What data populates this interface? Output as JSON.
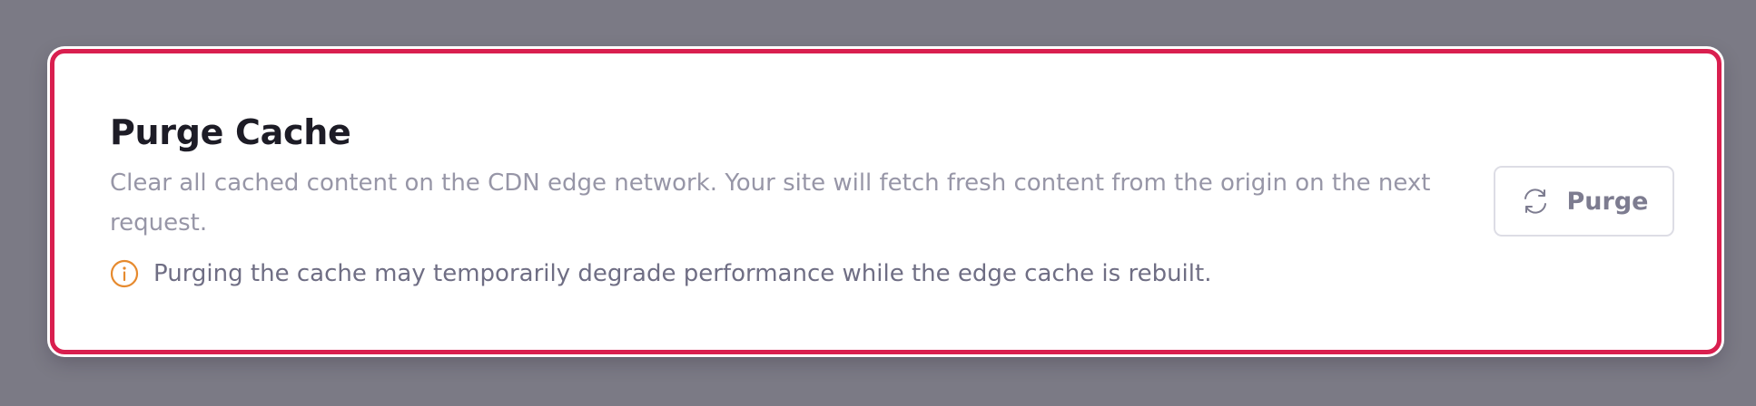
{
  "card": {
    "title": "Purge Cache",
    "description": "Clear all cached content on the CDN edge network. Your site will fetch fresh content from the origin on the next request.",
    "warning": {
      "icon": "info-circle-icon",
      "text": "Purging the cache may temporarily degrade performance while the edge cache is rebuilt."
    },
    "button": {
      "icon": "refresh-icon",
      "label": "Purge"
    }
  },
  "colors": {
    "overlay_background": "#7b7a85",
    "highlight_border": "#d91f4f",
    "warning_icon": "#e68a2e",
    "title": "#1d1c26",
    "description": "#9796a7",
    "button_text": "#7d7c90"
  }
}
